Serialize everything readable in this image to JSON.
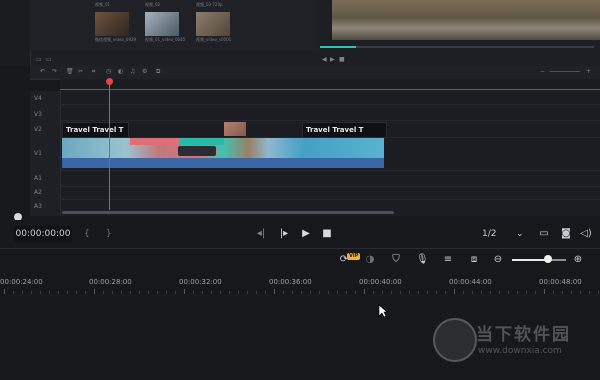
{
  "media_bin": {
    "items": [
      {
        "caption": "视频_01"
      },
      {
        "caption": "视频_02"
      },
      {
        "caption": "视频_03 720p"
      }
    ],
    "labels": [
      "微信视频_video_0929",
      "视频_01_video_0045",
      "视频_video_s0001"
    ]
  },
  "tracks": {
    "title_clips": [
      "Travel  Travel  T",
      "Travel  Travel  T"
    ],
    "track_labels": [
      "V4",
      "V3",
      "V2",
      "V1",
      "A1",
      "A2",
      "A3"
    ]
  },
  "player": {
    "timecode": "00:00:00:00",
    "in_bracket": "{",
    "out_bracket": "}",
    "ratio": "1/2"
  },
  "toolbar_icons": [
    "render-icon",
    "vip-badge",
    "shield-icon",
    "mic-icon",
    "list-icon",
    "transition-icon",
    "zoom-out-icon",
    "zoom-in-icon"
  ],
  "vip_text": "VIP",
  "zoom_level": 0.67,
  "ruler": {
    "labels": [
      "00:00:24:00",
      "00:00:28:00",
      "00:00:32:00",
      "00:00:36:00",
      "00:00:40:00",
      "00:00:44:00",
      "00:00:48:00"
    ]
  },
  "watermark": {
    "cn": "当下软件园",
    "url": "www.downxia.com"
  }
}
